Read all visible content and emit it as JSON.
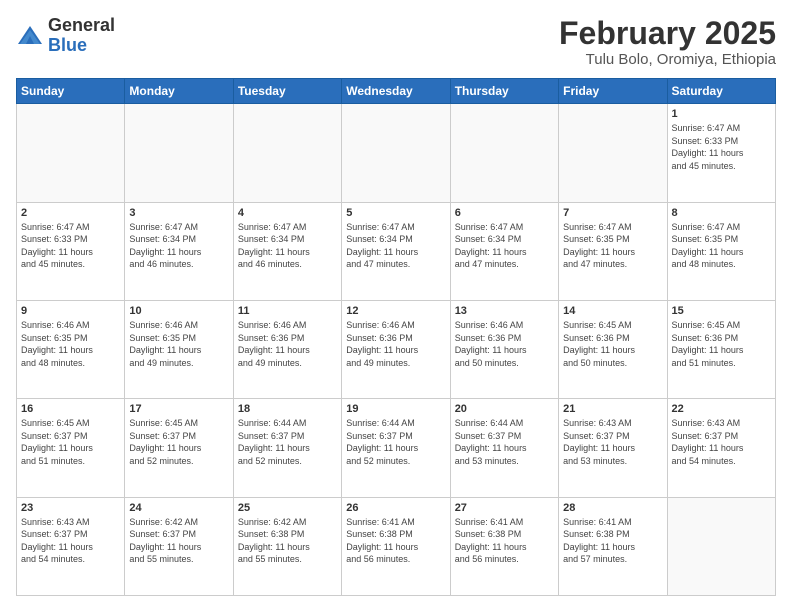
{
  "header": {
    "logo": {
      "general": "General",
      "blue": "Blue"
    },
    "title": "February 2025",
    "subtitle": "Tulu Bolo, Oromiya, Ethiopia"
  },
  "weekdays": [
    "Sunday",
    "Monday",
    "Tuesday",
    "Wednesday",
    "Thursday",
    "Friday",
    "Saturday"
  ],
  "weeks": [
    [
      {
        "day": "",
        "info": ""
      },
      {
        "day": "",
        "info": ""
      },
      {
        "day": "",
        "info": ""
      },
      {
        "day": "",
        "info": ""
      },
      {
        "day": "",
        "info": ""
      },
      {
        "day": "",
        "info": ""
      },
      {
        "day": "1",
        "info": "Sunrise: 6:47 AM\nSunset: 6:33 PM\nDaylight: 11 hours\nand 45 minutes."
      }
    ],
    [
      {
        "day": "2",
        "info": "Sunrise: 6:47 AM\nSunset: 6:33 PM\nDaylight: 11 hours\nand 45 minutes."
      },
      {
        "day": "3",
        "info": "Sunrise: 6:47 AM\nSunset: 6:34 PM\nDaylight: 11 hours\nand 46 minutes."
      },
      {
        "day": "4",
        "info": "Sunrise: 6:47 AM\nSunset: 6:34 PM\nDaylight: 11 hours\nand 46 minutes."
      },
      {
        "day": "5",
        "info": "Sunrise: 6:47 AM\nSunset: 6:34 PM\nDaylight: 11 hours\nand 47 minutes."
      },
      {
        "day": "6",
        "info": "Sunrise: 6:47 AM\nSunset: 6:34 PM\nDaylight: 11 hours\nand 47 minutes."
      },
      {
        "day": "7",
        "info": "Sunrise: 6:47 AM\nSunset: 6:35 PM\nDaylight: 11 hours\nand 47 minutes."
      },
      {
        "day": "8",
        "info": "Sunrise: 6:47 AM\nSunset: 6:35 PM\nDaylight: 11 hours\nand 48 minutes."
      }
    ],
    [
      {
        "day": "9",
        "info": "Sunrise: 6:46 AM\nSunset: 6:35 PM\nDaylight: 11 hours\nand 48 minutes."
      },
      {
        "day": "10",
        "info": "Sunrise: 6:46 AM\nSunset: 6:35 PM\nDaylight: 11 hours\nand 49 minutes."
      },
      {
        "day": "11",
        "info": "Sunrise: 6:46 AM\nSunset: 6:36 PM\nDaylight: 11 hours\nand 49 minutes."
      },
      {
        "day": "12",
        "info": "Sunrise: 6:46 AM\nSunset: 6:36 PM\nDaylight: 11 hours\nand 49 minutes."
      },
      {
        "day": "13",
        "info": "Sunrise: 6:46 AM\nSunset: 6:36 PM\nDaylight: 11 hours\nand 50 minutes."
      },
      {
        "day": "14",
        "info": "Sunrise: 6:45 AM\nSunset: 6:36 PM\nDaylight: 11 hours\nand 50 minutes."
      },
      {
        "day": "15",
        "info": "Sunrise: 6:45 AM\nSunset: 6:36 PM\nDaylight: 11 hours\nand 51 minutes."
      }
    ],
    [
      {
        "day": "16",
        "info": "Sunrise: 6:45 AM\nSunset: 6:37 PM\nDaylight: 11 hours\nand 51 minutes."
      },
      {
        "day": "17",
        "info": "Sunrise: 6:45 AM\nSunset: 6:37 PM\nDaylight: 11 hours\nand 52 minutes."
      },
      {
        "day": "18",
        "info": "Sunrise: 6:44 AM\nSunset: 6:37 PM\nDaylight: 11 hours\nand 52 minutes."
      },
      {
        "day": "19",
        "info": "Sunrise: 6:44 AM\nSunset: 6:37 PM\nDaylight: 11 hours\nand 52 minutes."
      },
      {
        "day": "20",
        "info": "Sunrise: 6:44 AM\nSunset: 6:37 PM\nDaylight: 11 hours\nand 53 minutes."
      },
      {
        "day": "21",
        "info": "Sunrise: 6:43 AM\nSunset: 6:37 PM\nDaylight: 11 hours\nand 53 minutes."
      },
      {
        "day": "22",
        "info": "Sunrise: 6:43 AM\nSunset: 6:37 PM\nDaylight: 11 hours\nand 54 minutes."
      }
    ],
    [
      {
        "day": "23",
        "info": "Sunrise: 6:43 AM\nSunset: 6:37 PM\nDaylight: 11 hours\nand 54 minutes."
      },
      {
        "day": "24",
        "info": "Sunrise: 6:42 AM\nSunset: 6:37 PM\nDaylight: 11 hours\nand 55 minutes."
      },
      {
        "day": "25",
        "info": "Sunrise: 6:42 AM\nSunset: 6:38 PM\nDaylight: 11 hours\nand 55 minutes."
      },
      {
        "day": "26",
        "info": "Sunrise: 6:41 AM\nSunset: 6:38 PM\nDaylight: 11 hours\nand 56 minutes."
      },
      {
        "day": "27",
        "info": "Sunrise: 6:41 AM\nSunset: 6:38 PM\nDaylight: 11 hours\nand 56 minutes."
      },
      {
        "day": "28",
        "info": "Sunrise: 6:41 AM\nSunset: 6:38 PM\nDaylight: 11 hours\nand 57 minutes."
      },
      {
        "day": "",
        "info": ""
      }
    ]
  ]
}
